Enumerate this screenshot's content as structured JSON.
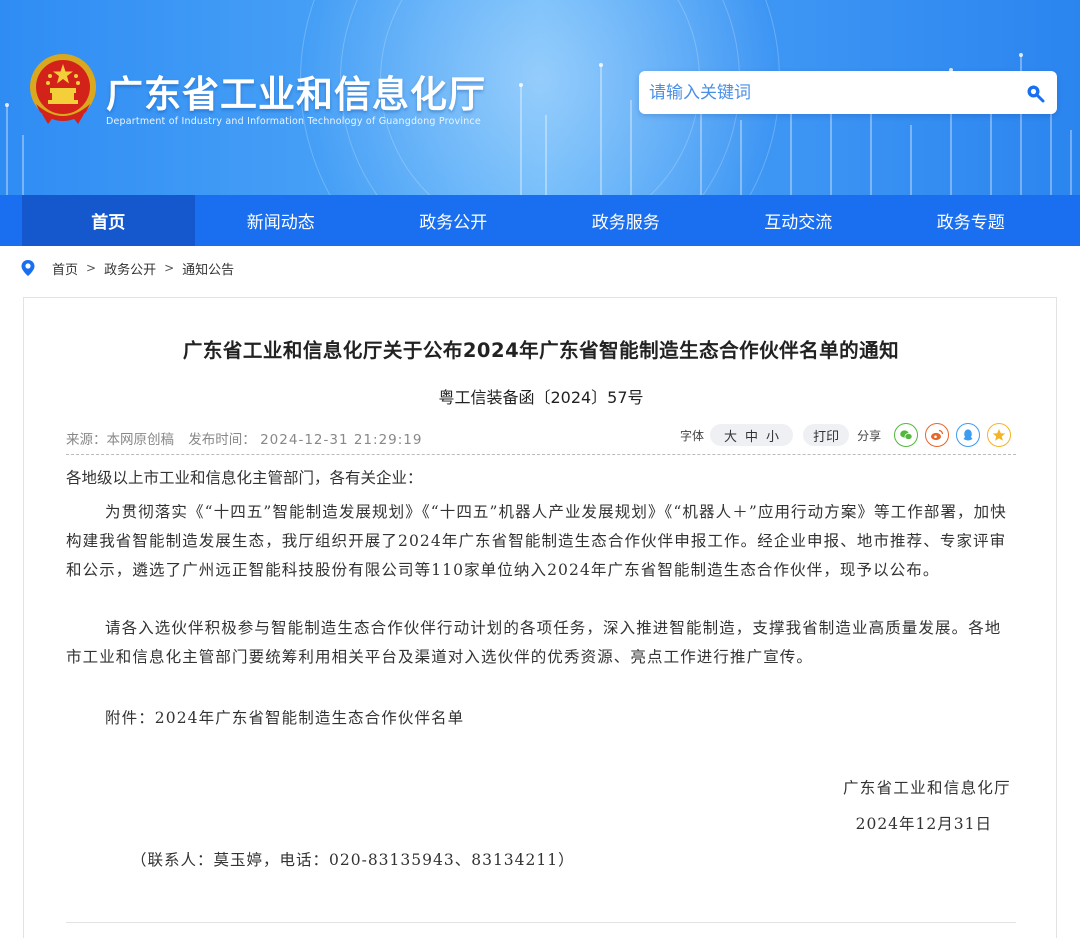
{
  "header": {
    "title": "广东省工业和信息化厅",
    "subtitle": "Department of Industry and Information Technology of Guangdong Province",
    "search_placeholder": "请输入关键词",
    "icons": {
      "emblem": "national-emblem",
      "search": "search-icon"
    },
    "colors": {
      "banner": "#3a97f5",
      "nav": "#1a6ff0",
      "nav_active": "#1557cc"
    }
  },
  "nav": {
    "items": [
      {
        "label": "首页",
        "active": true
      },
      {
        "label": "新闻动态",
        "active": false
      },
      {
        "label": "政务公开",
        "active": false
      },
      {
        "label": "政务服务",
        "active": false
      },
      {
        "label": "互动交流",
        "active": false
      },
      {
        "label": "政务专题",
        "active": false
      }
    ]
  },
  "breadcrumb": {
    "icon": "location-pin-icon",
    "items": [
      "首页",
      "政务公开",
      "通知公告"
    ],
    "separator": ">"
  },
  "article": {
    "title": "广东省工业和信息化厅关于公布2024年广东省智能制造生态合作伙伴名单的通知",
    "doc_number": "粤工信装备函〔2024〕57号",
    "source": "来源：本网原创稿",
    "publish_label": "发布时间：",
    "publish_time": "2024-12-31 21:29:19",
    "tools": {
      "font_label": "字体",
      "font_sizes": [
        "大",
        "中",
        "小"
      ],
      "print_label": "打印",
      "share_label": "分享",
      "share_icons": [
        {
          "name": "wechat-icon",
          "color": "#52b83b"
        },
        {
          "name": "weibo-icon",
          "color": "#e8652c"
        },
        {
          "name": "qq-icon",
          "color": "#3b9cf0"
        },
        {
          "name": "qzone-star-icon",
          "color": "#f3b525"
        }
      ]
    },
    "salutation": "各地级以上市工业和信息化主管部门，各有关企业：",
    "paragraphs": [
      "为贯彻落实《“十四五”智能制造发展规划》《“十四五”机器人产业发展规划》《“机器人＋”应用行动方案》等工作部署，加快构建我省智能制造发展生态，我厅组织开展了2024年广东省智能制造生态合作伙伴申报工作。经企业申报、地市推荐、专家评审和公示，遴选了广州远正智能科技股份有限公司等110家单位纳入2024年广东省智能制造生态合作伙伴，现予以公布。",
      "请各入选伙伴积极参与智能制造生态合作伙伴行动计划的各项任务，深入推进智能制造，支撑我省制造业高质量发展。各地市工业和信息化主管部门要统筹利用相关平台及渠道对入选伙伴的优秀资源、亮点工作进行推广宣传。",
      "附件：2024年广东省智能制造生态合作伙伴名单"
    ],
    "signer": "广东省工业和信息化厅",
    "sign_date": "2024年12月31日",
    "contact": "（联系人：莫玉婷，电话：020-83135943、83134211）"
  }
}
